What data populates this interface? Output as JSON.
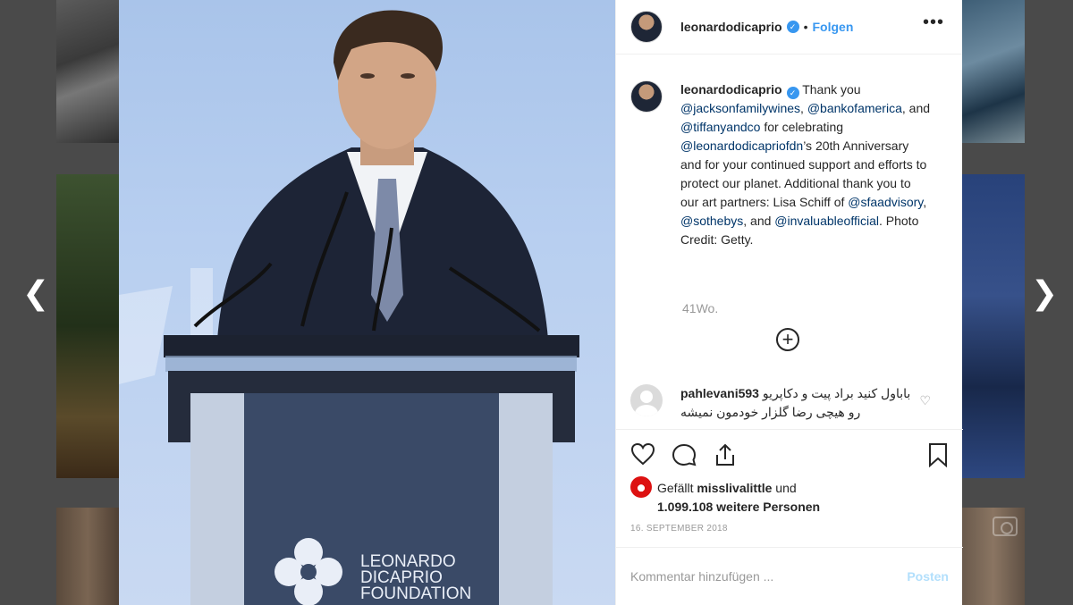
{
  "nav": {
    "prev_glyph": "❮",
    "next_glyph": "❯"
  },
  "post": {
    "username": "leonardodicaprio",
    "follow_label": "Folgen",
    "separator": "•",
    "more_glyph": "•••",
    "photo_logo_line1": "LEONARDO",
    "photo_logo_line2": "DICAPRIO",
    "photo_logo_line3": "FOUNDATION"
  },
  "caption": {
    "username": "leonardodicaprio",
    "part1": " Thank you ",
    "m1": "@jacksonfamilywines",
    "part2": ", ",
    "m2": "@bankofamerica",
    "part3": ", and ",
    "m3": "@tiffanyandco",
    "part4": " for celebrating ",
    "m4": "@leonardodicapriofdn",
    "part5": "’s 20th Anniversary and for your continued support and efforts to protect our planet. Additional thank you to our art partners: Lisa Schiff of ",
    "m5": "@sfaadvisory",
    "part6": ", ",
    "m6": "@sothebys",
    "part7": ", and ",
    "m7": "@invaluableofficial",
    "part8": ". Photo Credit: Getty.",
    "time": "41Wo.",
    "load_more_glyph": "+"
  },
  "comment": {
    "username": "pahlevani593",
    "text": "باباول کنید براد پیت و دکاپریو رو هیچی رضا گلزار خودمون نمیشه",
    "like_glyph": "♡"
  },
  "likes": {
    "prefix": "Gefällt ",
    "user": "misslivalittle",
    "mid": " und",
    "count": "1.099.108 weitere Personen"
  },
  "date": "16. SEPTEMBER 2018",
  "comment_input": {
    "placeholder": "Kommentar hinzufügen ...",
    "post_label": "Posten"
  }
}
